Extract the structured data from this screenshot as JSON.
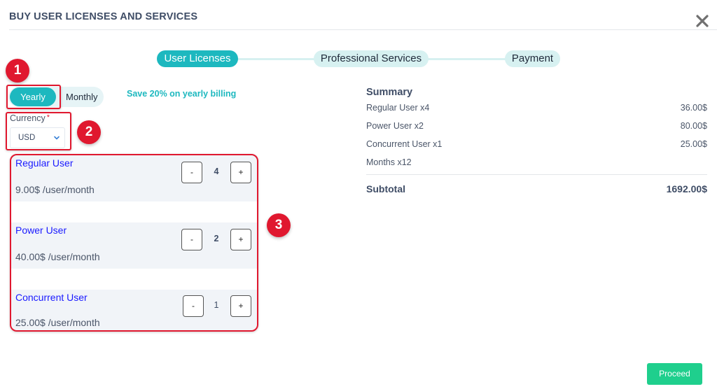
{
  "header": {
    "title": "BUY USER LICENSES AND SERVICES",
    "close_icon": "close-icon"
  },
  "stepper": {
    "steps": [
      {
        "label": "User Licenses",
        "active": true
      },
      {
        "label": "Professional Services",
        "active": false
      },
      {
        "label": "Payment",
        "active": false
      }
    ]
  },
  "annotations": {
    "badges": [
      "1",
      "2",
      "3"
    ]
  },
  "billing": {
    "options": [
      "Yearly",
      "Monthly"
    ],
    "selected": "Yearly",
    "save_note": "Save 20% on yearly billing"
  },
  "currency": {
    "label": "Currency",
    "required_mark": "*",
    "value": "USD"
  },
  "licenses": [
    {
      "name": "Regular User",
      "price": "9.00$ /user/month",
      "quantity": "4",
      "minus": "-",
      "plus": "+"
    },
    {
      "name": "Power User",
      "price": "40.00$ /user/month",
      "quantity": "2",
      "minus": "-",
      "plus": "+"
    },
    {
      "name": "Concurrent User",
      "price": "25.00$ /user/month",
      "quantity": "1",
      "minus": "-",
      "plus": "+"
    }
  ],
  "summary": {
    "title": "Summary",
    "rows": [
      {
        "label": "Regular User x4",
        "amount": "36.00$"
      },
      {
        "label": "Power User x2",
        "amount": "80.00$"
      },
      {
        "label": "Concurrent User x1",
        "amount": "25.00$"
      },
      {
        "label": "Months x12",
        "amount": ""
      }
    ],
    "subtotal_label": "Subtotal",
    "subtotal_amount": "1692.00$"
  },
  "footer": {
    "proceed_label": "Proceed"
  },
  "colors": {
    "accent": "#1db8bf",
    "accent_light": "#d7f1f1",
    "annotation_red": "#e0182f",
    "proceed_green": "#1fcf8d",
    "license_name_blue": "#1a1aff"
  }
}
